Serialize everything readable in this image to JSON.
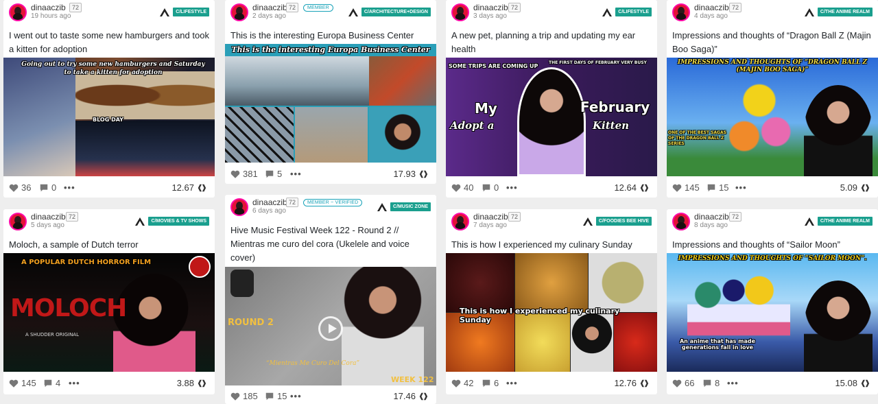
{
  "icons": {
    "heart": "heart-icon",
    "comment": "comment-icon",
    "more": "more-icon",
    "payout": "hive-icon",
    "community": "community-icon"
  },
  "colors": {
    "community_tag": "#1a9f8e",
    "badge": "#17a2b8",
    "avatar_ring": "#ff0aa8"
  },
  "cards": [
    {
      "author": "dinaaczib",
      "rep": "72",
      "time": "19 hours ago",
      "badge": "",
      "community": "C/LIFESTYLE",
      "title": "I went out to taste some new hamburgers and took a kitten for adoption",
      "thumb_caption": "Going out to try some new hamburgers and Saturday to take a kitten for adoption",
      "thumb_caption_2": "BLOG DAY",
      "likes": "36",
      "comments": "0",
      "payout": "12.67"
    },
    {
      "author": "dinaaczib",
      "rep": "72",
      "time": "2 days ago",
      "badge": "MEMBER",
      "community": "C/ARCHITECTURE+DESIGN",
      "title": "This is the interesting Europa Business Center",
      "thumb_caption": "This is the interesting Europa Business Center",
      "thumb_caption_2": "",
      "likes": "381",
      "comments": "5",
      "payout": "17.93"
    },
    {
      "author": "dinaaczib",
      "rep": "72",
      "time": "3 days ago",
      "badge": "",
      "community": "C/LIFESTYLE",
      "title": "A new pet, planning a trip and updating my ear health",
      "thumb_caption": "SOME TRIPS ARE COMING UP",
      "thumb_caption_2": "THE FIRST DAYS OF FEBRUARY VERY BUSY",
      "thumb_word_1": "My",
      "thumb_word_2": "February",
      "thumb_word_3": "Adopt a",
      "thumb_word_4": "Kitten",
      "likes": "40",
      "comments": "0",
      "payout": "12.64"
    },
    {
      "author": "dinaaczib",
      "rep": "72",
      "time": "4 days ago",
      "badge": "",
      "community": "C/THE ANIME REALM",
      "title": "Impressions and thoughts of “Dragon Ball Z (Majin Boo Saga)”",
      "thumb_caption": "IMPRESSIONS AND THOUGHTS OF “DRAGON BALL Z (MAJIN BOO SAGA)”",
      "thumb_caption_2": "ONE OF THE BEST SAGAS OF THE DRAGON BALL Z SERIES",
      "likes": "145",
      "comments": "15",
      "payout": "5.09"
    },
    {
      "author": "dinaaczib",
      "rep": "72",
      "time": "5 days ago",
      "badge": "",
      "community": "C/MOVIES & TV SHOWS",
      "title": "Moloch, a sample of Dutch terror",
      "thumb_caption": "A POPULAR DUTCH HORROR FILM",
      "thumb_caption_2": "MOLOCH",
      "thumb_word_1": "A SHUDDER ORIGINAL",
      "likes": "145",
      "comments": "4",
      "payout": "3.88"
    },
    {
      "author": "dinaaczib",
      "rep": "72",
      "time": "6 days ago",
      "badge": "MEMBER ~ VERIFIED",
      "community": "C/MUSIC ZONE",
      "title": "Hive Music Festival Week 122 - Round 2 // Mientras me curo del cora (Ukelele and voice cover)",
      "thumb_caption": "ROUND 2",
      "thumb_caption_2": "“Mientras Me Curo Del Cora”",
      "thumb_word_1": "WEEK 122",
      "likes": "185",
      "comments": "15",
      "payout": "17.46"
    },
    {
      "author": "dinaaczib",
      "rep": "72",
      "time": "7 days ago",
      "badge": "",
      "community": "C/FOODIES BEE HIVE",
      "title": "This is how I experienced my culinary Sunday",
      "thumb_caption": "This is how I experienced my culinary Sunday",
      "thumb_caption_2": "",
      "likes": "42",
      "comments": "6",
      "payout": "12.76"
    },
    {
      "author": "dinaaczib",
      "rep": "72",
      "time": "8 days ago",
      "badge": "",
      "community": "C/THE ANIME REALM",
      "title": "Impressions and thoughts of “Sailor Moon”",
      "thumb_caption": "IMPRESSIONS AND THOUGHTS OF “SAILOR MOON”.",
      "thumb_caption_2": "An anime that has made generations fall in love",
      "likes": "66",
      "comments": "8",
      "payout": "15.08"
    }
  ]
}
